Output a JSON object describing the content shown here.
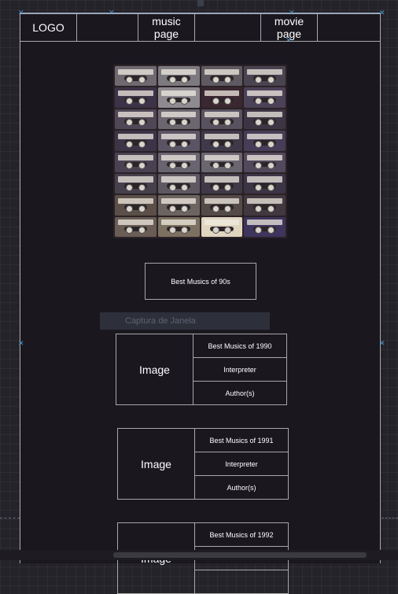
{
  "nav": {
    "logo": "LOGO",
    "music_link": "music\npage",
    "movie_link": "movie\npage"
  },
  "hero": {
    "icon": "cassette-collection-image",
    "tape_colors": [
      "#6f6a70",
      "#7d7a7f",
      "#5f5a62",
      "#4a4350",
      "#3c3348",
      "#8d8a90",
      "#3a2730",
      "#4b4258",
      "#4f4656",
      "#6b6670",
      "#585260",
      "#3d3544",
      "#3c3548",
      "#5a5565",
      "#3f3a4a",
      "#463d58",
      "#4a4252",
      "#686470",
      "#6a6670",
      "#53495c",
      "#463f4c",
      "#5e5863",
      "#403947",
      "#3b3546",
      "#5b4f48",
      "#6c6460",
      "#544b48",
      "#42383f",
      "#6a5d55",
      "#7c7060",
      "#e0d6c0",
      "#3d355c"
    ]
  },
  "section_title": "Best Musics of 90s",
  "tooltip": "Captura de Janela",
  "cards": [
    {
      "image_label": "Image",
      "title": "Best Musics of 1990",
      "interpreter": "Interpreter",
      "authors": "Author(s)"
    },
    {
      "image_label": "Image",
      "title": "Best Musics of 1991",
      "interpreter": "Interpreter",
      "authors": "Author(s)"
    },
    {
      "image_label": "Image",
      "title": "Best Musics of 1992",
      "interpreter": "",
      "authors": ""
    }
  ],
  "colors": {
    "background": "#25232a",
    "frame": "#1a171f",
    "border": "#a8a8a8",
    "handle": "#4a9bd6"
  }
}
